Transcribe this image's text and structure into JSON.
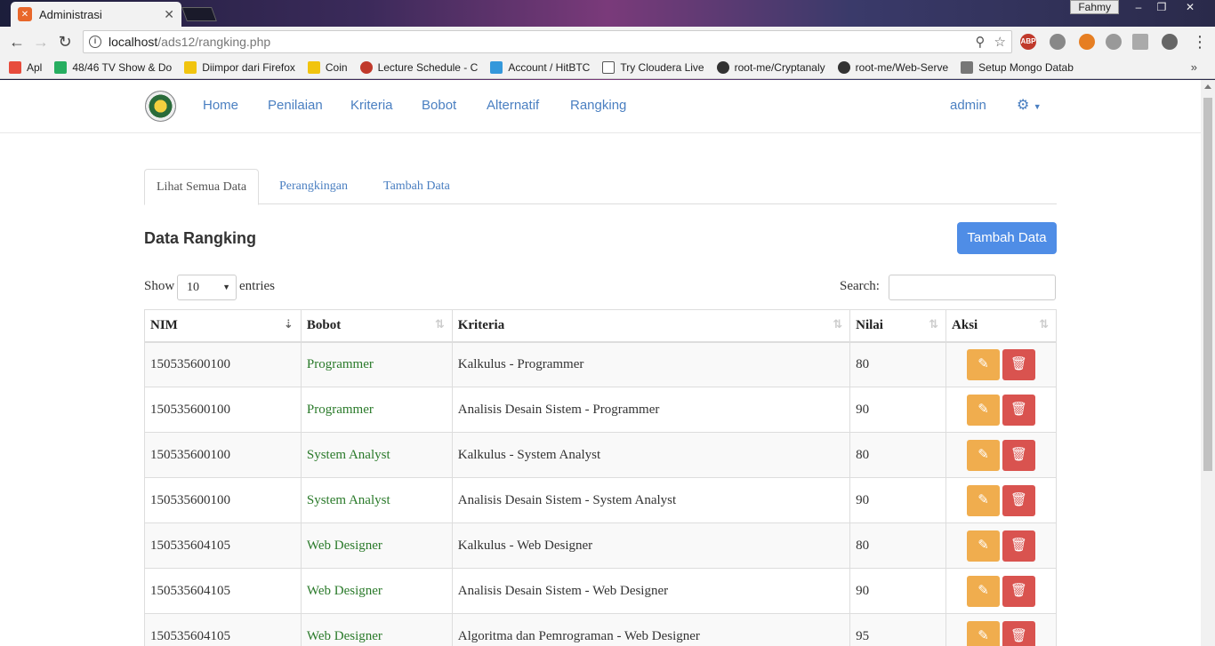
{
  "browser": {
    "tab_title": "Administrasi",
    "user": "Fahmy",
    "url_host": "localhost",
    "url_path": "/ads12/rangking.php",
    "bookmarks": [
      "Apl",
      "48/46 TV Show & Do",
      "Diimpor dari Firefox",
      "Coin",
      "Lecture Schedule - C",
      "Account / HitBTC",
      "Try Cloudera Live",
      "root-me/Cryptanaly",
      "root-me/Web-Serve",
      "Setup Mongo Datab"
    ],
    "bookmarks_more": "»"
  },
  "navbar": {
    "links": [
      "Home",
      "Penilaian",
      "Kriteria",
      "Bobot",
      "Alternatif",
      "Rangking"
    ],
    "user": "admin"
  },
  "tabs": [
    "Lihat Semua Data",
    "Perangkingan",
    "Tambah Data"
  ],
  "page_title": "Data Rangking",
  "add_button": "Tambah Data",
  "controls": {
    "show_label": "Show",
    "show_value": "10",
    "entries_label": "entries",
    "search_label": "Search:"
  },
  "table": {
    "headers": [
      "NIM",
      "Bobot",
      "Kriteria",
      "Nilai",
      "Aksi"
    ],
    "rows": [
      {
        "nim": "150535600100",
        "bobot": "Programmer",
        "kriteria": "Kalkulus - Programmer",
        "nilai": "80"
      },
      {
        "nim": "150535600100",
        "bobot": "Programmer",
        "kriteria": "Analisis Desain Sistem - Programmer",
        "nilai": "90"
      },
      {
        "nim": "150535600100",
        "bobot": "System Analyst",
        "kriteria": "Kalkulus - System Analyst",
        "nilai": "80"
      },
      {
        "nim": "150535600100",
        "bobot": "System Analyst",
        "kriteria": "Analisis Desain Sistem - System Analyst",
        "nilai": "90"
      },
      {
        "nim": "150535604105",
        "bobot": "Web Designer",
        "kriteria": "Kalkulus - Web Designer",
        "nilai": "80"
      },
      {
        "nim": "150535604105",
        "bobot": "Web Designer",
        "kriteria": "Analisis Desain Sistem - Web Designer",
        "nilai": "90"
      },
      {
        "nim": "150535604105",
        "bobot": "Web Designer",
        "kriteria": "Algoritma dan Pemrograman - Web Designer",
        "nilai": "95"
      }
    ]
  },
  "colors": {
    "link": "#4a7fc1",
    "primary_button": "#4f8de6",
    "edit_button": "#f0ad4e",
    "delete_button": "#d9534f",
    "bobot_text": "#2a7a2a"
  }
}
